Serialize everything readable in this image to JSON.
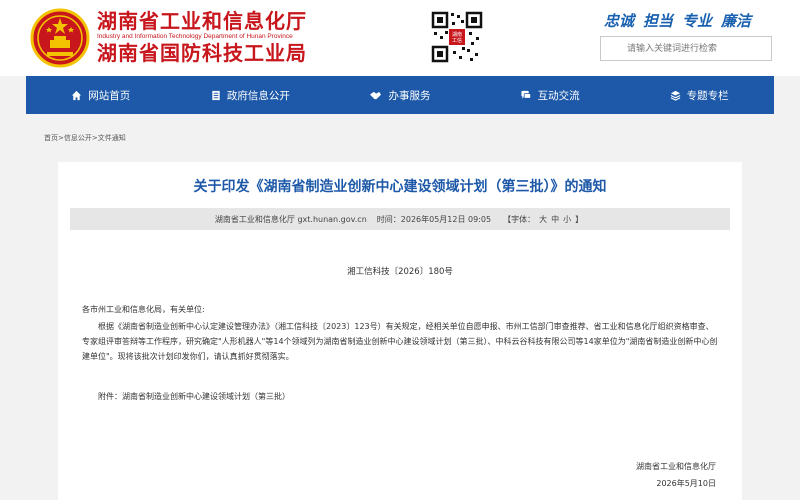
{
  "header": {
    "title_line1": "湖南省工业和信息化厅",
    "title_en": "Industry and Information Technology Department of Hunan Province",
    "title_line2": "湖南省国防科技工业局",
    "qr_label": "湖南\n工信",
    "slogan": [
      "忠诚",
      "担当",
      "专业",
      "廉洁"
    ],
    "search_placeholder": "请输入关键词进行检索"
  },
  "nav": {
    "items": [
      {
        "label": "网站首页",
        "icon": "home-icon"
      },
      {
        "label": "政府信息公开",
        "icon": "document-icon"
      },
      {
        "label": "办事服务",
        "icon": "handshake-icon"
      },
      {
        "label": "互动交流",
        "icon": "chat-icon"
      },
      {
        "label": "专题专栏",
        "icon": "layers-icon"
      }
    ]
  },
  "breadcrumb": {
    "home": "首页",
    "level1": "信息公开",
    "level2": "文件通知",
    "separator": ">"
  },
  "article": {
    "title": "关于印发《湖南省制造业创新中心建设领域计划（第三批）》的通知",
    "meta": {
      "source": "湖南省工业和信息化厅 gxt.hunan.gov.cn",
      "time": "时间：2026年05月12日 09:05",
      "font_open": "【字体：",
      "font_large": "大",
      "font_medium": "中",
      "font_small": "小",
      "font_close": "】"
    },
    "doc_no": "湘工信科技〔2026〕180号",
    "addressee": "各市州工业和信息化局，有关单位:",
    "body": "根据《湖南省制造业创新中心认定建设管理办法》（湘工信科技〔2023〕123号）有关规定，经相关单位自愿申报、市州工信部门审查推荐、省工业和信息化厅组织资格审查、专家组评审答辩等工作程序，研究确定\"人形机器人\"等14个领域列为湖南省制造业创新中心建设领域计划（第三批）、中科云谷科技有限公司等14家单位为\"湖南省制造业创新中心创建单位\"。现将该批次计划印发你们，请认真抓好贯彻落实。",
    "attachment": "附件：湖南省制造业创新中心建设领域计划（第三批）",
    "sign_org": "湖南省工业和信息化厅",
    "sign_date": "2026年5月10日"
  },
  "colors": {
    "brand_red": "#c8161d",
    "nav_blue": "#1d59a8",
    "title_blue": "#1d59a8",
    "gold": "#f3c200"
  }
}
